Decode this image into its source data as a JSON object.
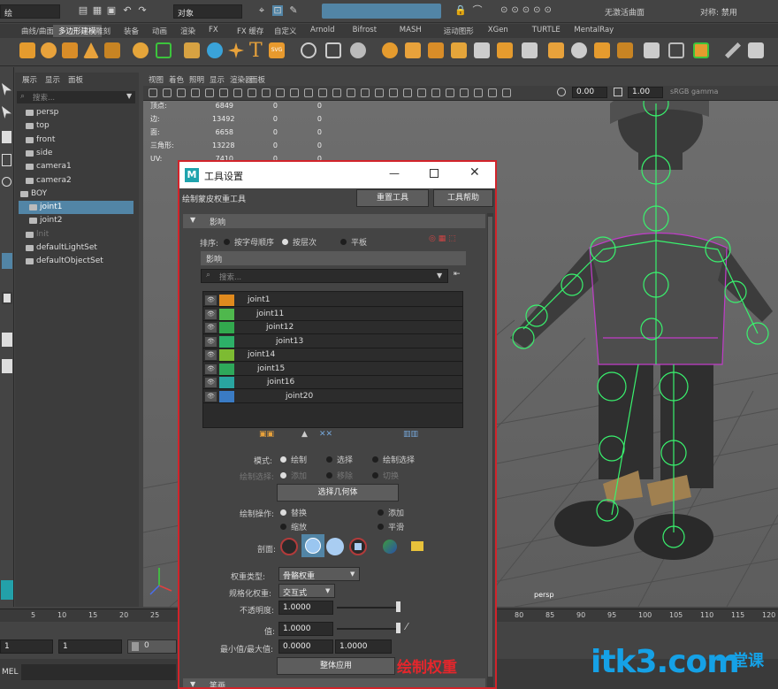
{
  "topbar": {
    "mode_menu": "绘",
    "object_menu": "对象",
    "live_surface": "无激活曲面",
    "symmetry": "对称: 禁用"
  },
  "shelf_tabs": [
    "曲线/曲面",
    "多边形建模",
    "雕刻",
    "装备",
    "动画",
    "渲染",
    "FX",
    "FX 缓存",
    "自定义",
    "Arnold",
    "Bifrost",
    "MASH",
    "运动图形",
    "XGen",
    "TURTLE",
    "MentalRay"
  ],
  "shelf_active_tab": "多边形建模",
  "outliner": {
    "menu": [
      "展示",
      "显示",
      "面板"
    ],
    "search_placeholder": "搜索...",
    "items": [
      "persp",
      "top",
      "front",
      "side",
      "camera1",
      "camera2",
      "BOY",
      "joint1",
      "joint2",
      "lnit",
      "defaultLightSet",
      "defaultObjectSet"
    ]
  },
  "viewport": {
    "menu": [
      "视图",
      "着色",
      "照明",
      "显示",
      "渲染器",
      "面板"
    ],
    "gamma": "0.00",
    "exposure": "1.00",
    "colorspace": "sRGB gamma",
    "hud": [
      {
        "label": "顶点:",
        "v1": "6849",
        "v2": "0",
        "v3": "0"
      },
      {
        "label": "边:",
        "v1": "13492",
        "v2": "0",
        "v3": "0"
      },
      {
        "label": "面:",
        "v1": "6658",
        "v2": "0",
        "v3": "0"
      },
      {
        "label": "三角形:",
        "v1": "13228",
        "v2": "0",
        "v3": "0"
      },
      {
        "label": "UV:",
        "v1": "7410",
        "v2": "0",
        "v3": "0"
      }
    ],
    "camera_label": "persp"
  },
  "timeline": {
    "ticks": [
      "5",
      "10",
      "15",
      "20",
      "25",
      "80",
      "85",
      "90",
      "95",
      "100",
      "105",
      "110",
      "115",
      "120"
    ],
    "start": "1",
    "current": "1",
    "range_field": "0"
  },
  "mel_label": "MEL",
  "dialog": {
    "title": "工具设置",
    "tool_name": "绘制蒙皮权重工具",
    "reset_button": "重置工具",
    "help_button": "工具帮助",
    "influence_section": "影响",
    "sort_label": "排序:",
    "sort_options": [
      "按字母顺序",
      "按层次",
      "平板"
    ],
    "influence_sub": "影响",
    "search_placeholder": "搜索...",
    "joints": [
      {
        "name": "joint1",
        "color": "#e08a1e"
      },
      {
        "name": "joint11",
        "color": "#4fb84d"
      },
      {
        "name": "joint12",
        "color": "#32a94e"
      },
      {
        "name": "joint13",
        "color": "#2db068"
      },
      {
        "name": "joint14",
        "color": "#7dbb32"
      },
      {
        "name": "joint15",
        "color": "#2ea85a"
      },
      {
        "name": "joint16",
        "color": "#29a5a0"
      },
      {
        "name": "joint20",
        "color": "#3a7bc4"
      }
    ],
    "mode_label": "模式:",
    "mode_options": [
      "绘制",
      "选择",
      "绘制选择"
    ],
    "sel_label": "绘制选择:",
    "sel_options": [
      "添加",
      "移除",
      "切换"
    ],
    "select_geometry": "选择几何体",
    "paint_op_label": "绘制操作:",
    "paint_ops": [
      "替换",
      "添加",
      "缩放",
      "平滑"
    ],
    "profile_label": "剖面:",
    "weight_type_label": "权重类型:",
    "weight_type_value": "骨骼权重",
    "normalize_label": "规格化权重:",
    "normalize_value": "交互式",
    "opacity_label": "不透明度:",
    "opacity_value": "1.0000",
    "value_label": "值:",
    "value_value": "1.0000",
    "minmax_label": "最小值/最大值:",
    "min_value": "0.0000",
    "max_value": "1.0000",
    "flood_button": "整体应用",
    "annotation": "绘制权重",
    "bottom_section": "笔画"
  },
  "watermark": {
    "site": "itk3.com",
    "cn": "一堂课"
  }
}
